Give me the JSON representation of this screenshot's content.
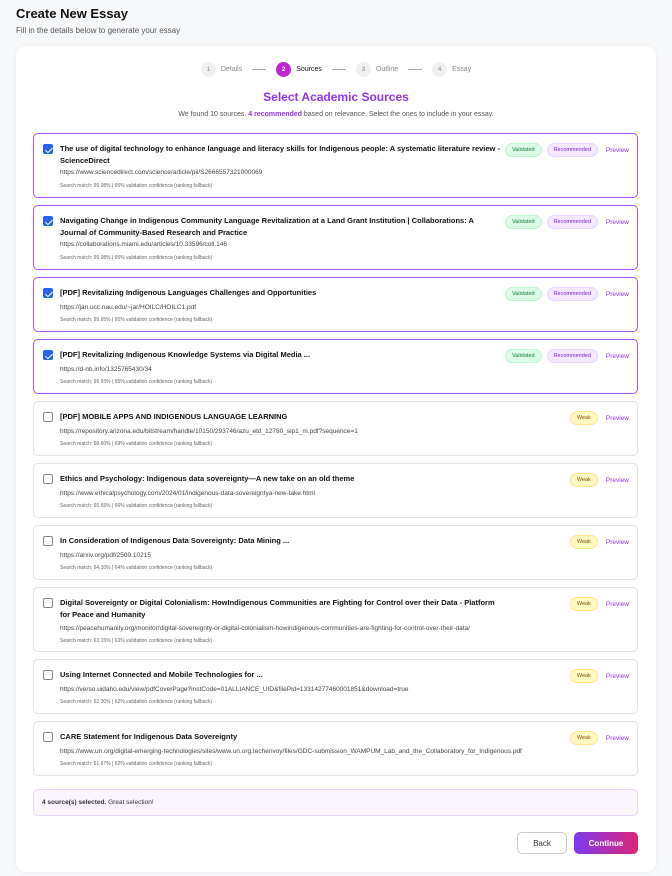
{
  "page": {
    "title": "Create New Essay",
    "subtitle": "Fill in the details below to generate your essay"
  },
  "stepper": [
    {
      "num": "1",
      "label": "Details"
    },
    {
      "num": "2",
      "label": "Sources"
    },
    {
      "num": "3",
      "label": "Outline"
    },
    {
      "num": "4",
      "label": "Essay"
    }
  ],
  "heading": "Select Academic Sources",
  "intro": {
    "before": "We found 10 sources.",
    "highlight": "4 recommended",
    "after": "based on relevance. Select the ones to include in your essay."
  },
  "labels": {
    "validated": "Validated",
    "recommended": "Recommended",
    "weak": "Weak",
    "preview": "Preview"
  },
  "sources": [
    {
      "selected": true,
      "title": "The use of digital technology to enhance language and literacy skills for Indigenous people: A systematic literature review - ScienceDirect",
      "url": "https://www.sciencedirect.com/science/article/pii/S2666557321000069",
      "meta": "Search match: 99.98% | 95% validation confidence (ranking fallback)",
      "status": "validated"
    },
    {
      "selected": true,
      "title": "Navigating Change in Indigenous Community Language Revitalization at a Land Grant Institution | Collaborations: A Journal of Community-Based Research and Practice",
      "url": "https://collaborations.miami.edu/articles/10.33596/coll.146",
      "meta": "Search match: 99.98% | 95% validation confidence (ranking fallback)",
      "status": "validated"
    },
    {
      "selected": true,
      "title": "[PDF] Revitalizing Indigenous Languages Challenges and Opportunities",
      "url": "https://jan.ucc.nau.edu/~jar/HOILC/HOILC1.pdf",
      "meta": "Search match: 99.95% | 95% validation confidence (ranking fallback)",
      "status": "validated"
    },
    {
      "selected": true,
      "title": "[PDF] Revitalizing Indigenous Knowledge Systems via Digital Media ...",
      "url": "https://d-nb.info/1325765430/34",
      "meta": "Search match: 99.93% | 95% validation confidence (ranking fallback)",
      "status": "validated"
    },
    {
      "selected": false,
      "title": "[PDF] MOBILE APPS AND INDIGENOUS LANGUAGE LEARNING",
      "url": "https://repository.arizona.edu/bitstream/handle/10150/293746/azu_etd_12780_sip1_m.pdf?sequence=1",
      "meta": "Search match: 68.60% | 69% validation confidence (ranking fallback)",
      "status": "weak"
    },
    {
      "selected": false,
      "title": "Ethics and Psychology: Indigenous data sovereignty—A new take on an old theme",
      "url": "https://www.ethicalpsychology.com/2024/01/indigenous-data-sovereigntya-new-take.html",
      "meta": "Search match: 65.65% | 66% validation confidence (ranking fallback)",
      "status": "weak"
    },
    {
      "selected": false,
      "title": "In Consideration of Indigenous Data Sovereignty: Data Mining ...",
      "url": "https://arxiv.org/pdf/2509.10215",
      "meta": "Search match: 64.10% | 64% validation confidence (ranking fallback)",
      "status": "weak"
    },
    {
      "selected": false,
      "title": "Digital Sovereignty or Digital Colonialism: HowIndigenous Communities are Fighting for Control over their Data - Platform for Peace and Humanity",
      "url": "https://peacehumanity.org/monitor/digital-sovereignty-or-digital-colonialism-howindigenous-communities-are-fighting-for-control-over-their-data/",
      "meta": "Search match: 63.15% | 63% validation confidence (ranking fallback)",
      "status": "weak"
    },
    {
      "selected": false,
      "title": "Using Internet Connected and Mobile Technologies for ...",
      "url": "https://verso.uidaho.edu/view/pdfCoverPage?instCode=01ALLIANCE_UID&filePid=13314277460001851&download=true",
      "meta": "Search match: 62.30% | 62% validation confidence (ranking fallback)",
      "status": "weak"
    },
    {
      "selected": false,
      "title": "CARE Statement for Indigenous Data Sovereignty",
      "url": "https://www.un.org/digital-emerging-technologies/sites/www.un.org.techenvoy/files/GDC-submission_WAMPUM_Lab_and_the_Collaboratory_for_Indigenous.pdf",
      "meta": "Search match: 61.67% | 62% validation confidence (ranking fallback)",
      "status": "weak"
    }
  ],
  "summary": {
    "count": "4 source(s) selected.",
    "message": "Great selection!"
  },
  "buttons": {
    "back": "Back",
    "continue": "Continue"
  }
}
